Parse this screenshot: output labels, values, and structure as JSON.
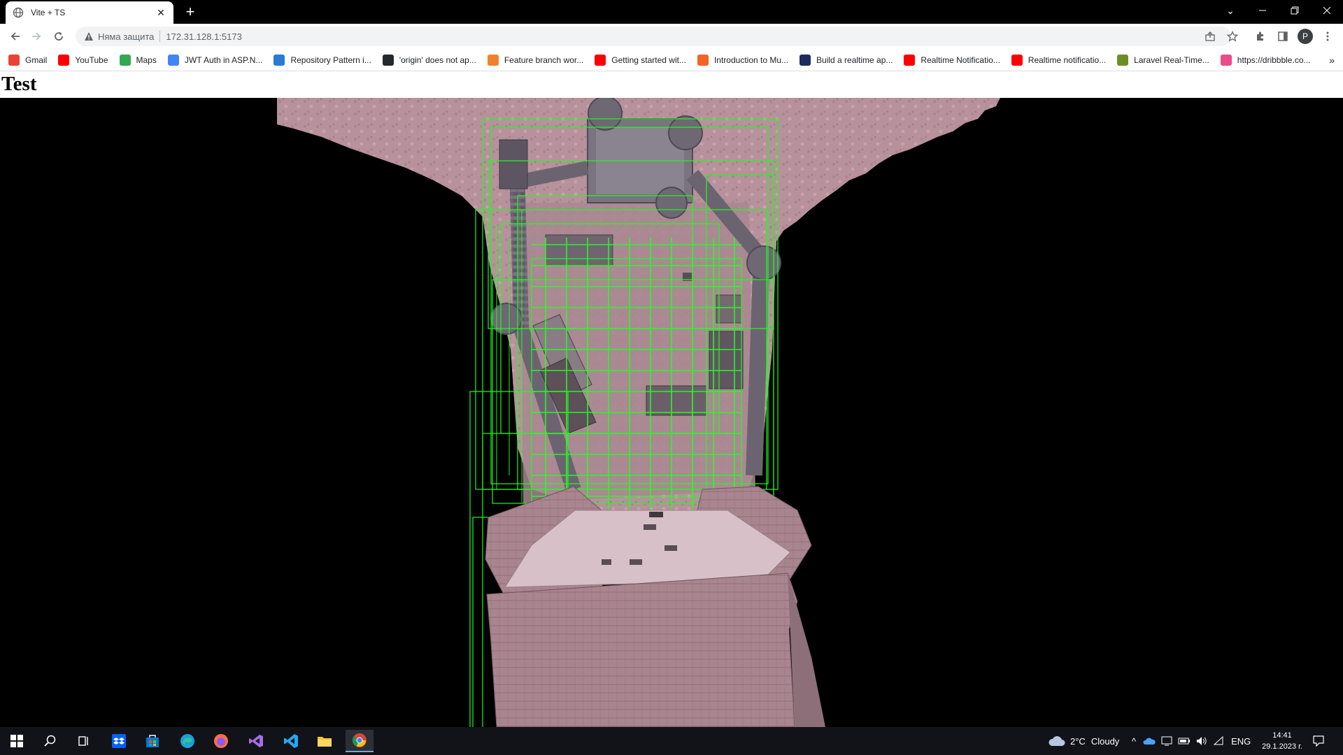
{
  "browser": {
    "tab_title": "Vite + TS",
    "new_tab_symbol": "+",
    "security_label": "Няма защита",
    "url": "172.31.128.1:5173",
    "profile_initial": "P",
    "bookmarks": [
      {
        "label": "Gmail",
        "icon": "gmail-icon",
        "color": "#ea4335"
      },
      {
        "label": "YouTube",
        "icon": "youtube-icon",
        "color": "#ff0000"
      },
      {
        "label": "Maps",
        "icon": "maps-icon",
        "color": "#34a853"
      },
      {
        "label": "JWT Auth in ASP.N...",
        "icon": "site-icon",
        "color": "#4285f4"
      },
      {
        "label": "Repository Pattern i...",
        "icon": "site-icon",
        "color": "#2b7bd3"
      },
      {
        "label": "'origin' does not ap...",
        "icon": "github-icon",
        "color": "#24292e"
      },
      {
        "label": "Feature branch wor...",
        "icon": "site-icon",
        "color": "#f0822e"
      },
      {
        "label": "Getting started wit...",
        "icon": "youtube-icon",
        "color": "#ff0000"
      },
      {
        "label": "Introduction to Mu...",
        "icon": "site-icon",
        "color": "#f26522"
      },
      {
        "label": "Build a realtime ap...",
        "icon": "site-icon",
        "color": "#1c2a5c"
      },
      {
        "label": "Realtime Notificatio...",
        "icon": "youtube-icon",
        "color": "#ff0000"
      },
      {
        "label": "Realtime notificatio...",
        "icon": "youtube-icon",
        "color": "#ff0000"
      },
      {
        "label": "Laravel Real-Time...",
        "icon": "site-icon",
        "color": "#6b8e23"
      },
      {
        "label": "https://dribbble.co...",
        "icon": "dribbble-icon",
        "color": "#ea4c89"
      }
    ],
    "bookmarks_overflow": "»"
  },
  "page": {
    "heading": "Test"
  },
  "taskbar": {
    "weather_temp": "2°C",
    "weather_text": "Cloudy",
    "language": "ENG",
    "time": "14:41",
    "date": "29.1.2023 г."
  }
}
